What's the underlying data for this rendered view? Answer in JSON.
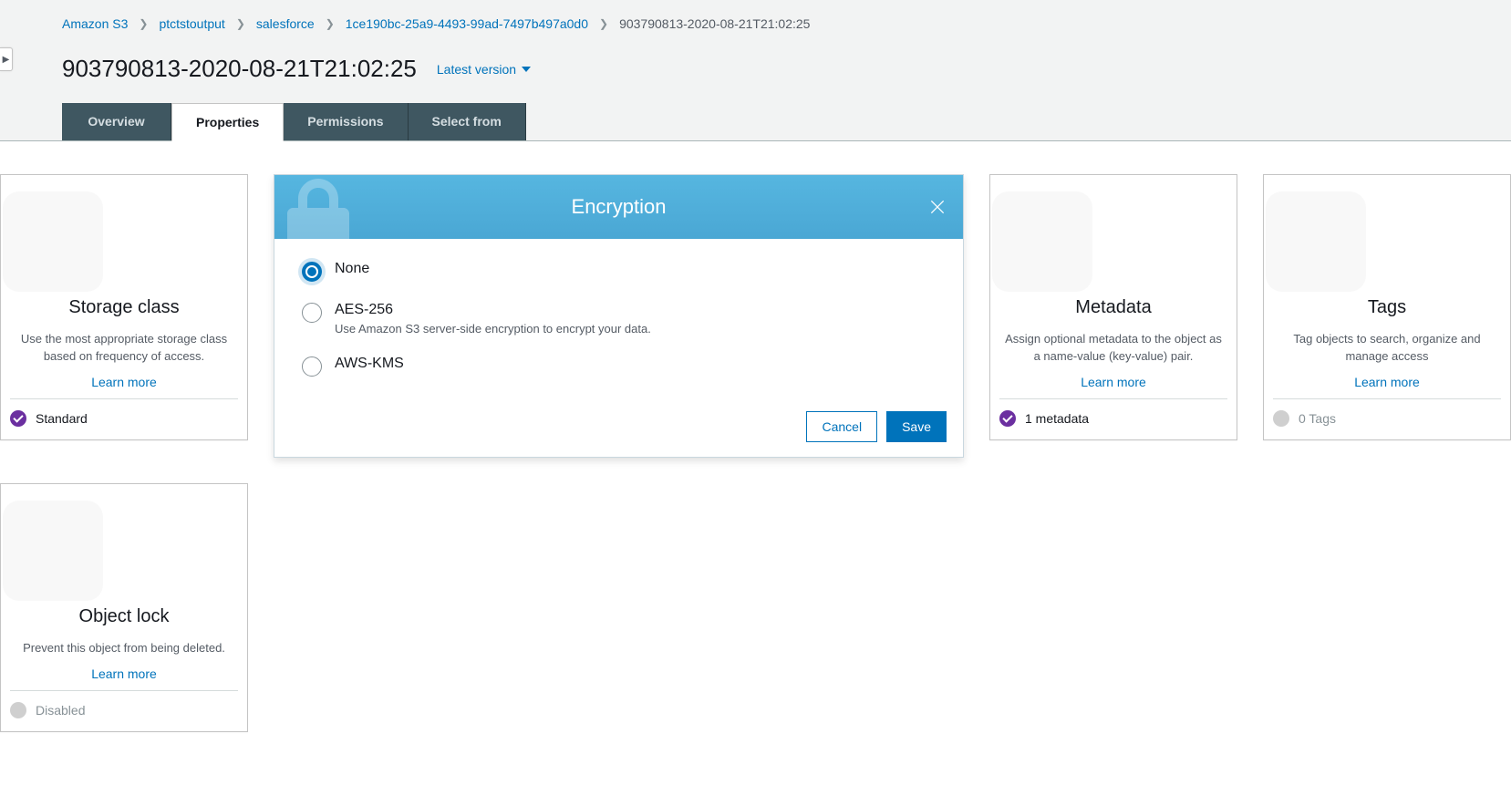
{
  "breadcrumbs": {
    "items": [
      {
        "label": "Amazon S3"
      },
      {
        "label": "ptctstoutput"
      },
      {
        "label": "salesforce"
      },
      {
        "label": "1ce190bc-25a9-4493-99ad-7497b497a0d0"
      }
    ],
    "current": "903790813-2020-08-21T21:02:25"
  },
  "header": {
    "title": "903790813-2020-08-21T21:02:25",
    "version_label": "Latest version"
  },
  "tabs": {
    "overview": "Overview",
    "properties": "Properties",
    "permissions": "Permissions",
    "select_from": "Select from"
  },
  "cards": {
    "storage_class": {
      "title": "Storage class",
      "desc": "Use the most appropriate storage class based on frequency of access.",
      "learn": "Learn more",
      "status": "Standard"
    },
    "encryption": {
      "title": "Encryption",
      "options": {
        "none": {
          "label": "None"
        },
        "aes": {
          "label": "AES-256",
          "sub": "Use Amazon S3 server-side encryption to encrypt your data."
        },
        "kms": {
          "label": "AWS-KMS"
        }
      },
      "cancel": "Cancel",
      "save": "Save"
    },
    "metadata": {
      "title": "Metadata",
      "desc": "Assign optional metadata to the object as a name-value (key-value) pair.",
      "learn": "Learn more",
      "status": "1 metadata"
    },
    "tags": {
      "title": "Tags",
      "desc": "Tag objects to search, organize and manage access",
      "learn": "Learn more",
      "status": "0 Tags"
    },
    "object_lock": {
      "title": "Object lock",
      "desc": "Prevent this object from being deleted.",
      "learn": "Learn more",
      "status": "Disabled"
    }
  }
}
